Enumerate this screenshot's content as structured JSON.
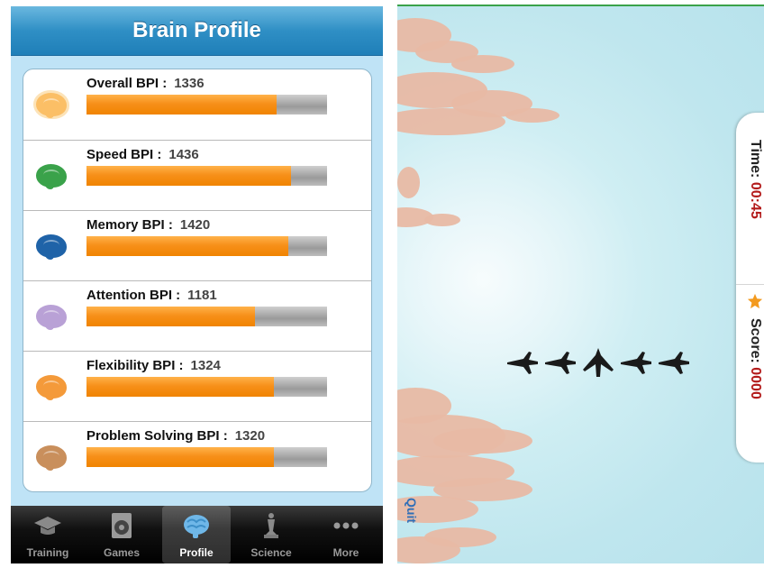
{
  "left_panel": {
    "title": "Brain Profile",
    "rows": [
      {
        "label": "Overall BPI :",
        "value": "1336",
        "fill": 0.79,
        "brain_color": "#f6a13a"
      },
      {
        "label": "Speed BPI :",
        "value": "1436",
        "fill": 0.85,
        "brain_color": "#3aa24a"
      },
      {
        "label": "Memory BPI :",
        "value": "1420",
        "fill": 0.84,
        "brain_color": "#1f63a8"
      },
      {
        "label": "Attention BPI :",
        "value": "1181",
        "fill": 0.7,
        "brain_color": "#b9a1d6"
      },
      {
        "label": "Flexibility BPI :",
        "value": "1324",
        "fill": 0.78,
        "brain_color": "#f49a3a"
      },
      {
        "label": "Problem Solving BPI :",
        "value": "1320",
        "fill": 0.78,
        "brain_color": "#c98f5c"
      }
    ],
    "tabs": [
      {
        "label": "Training",
        "icon": "graduation-cap-icon",
        "active": false
      },
      {
        "label": "Games",
        "icon": "speaker-icon",
        "active": false
      },
      {
        "label": "Profile",
        "icon": "brain-icon",
        "active": true
      },
      {
        "label": "Science",
        "icon": "chess-piece-icon",
        "active": false
      },
      {
        "label": "More",
        "icon": "more-dots-icon",
        "active": false
      }
    ]
  },
  "game_panel": {
    "time_label": "Time:",
    "time_value": "00:45",
    "score_label": "Score:",
    "score_value": "0000",
    "quit_label": "Quit",
    "bird_directions": [
      "right",
      "right",
      "up",
      "right",
      "right"
    ]
  }
}
